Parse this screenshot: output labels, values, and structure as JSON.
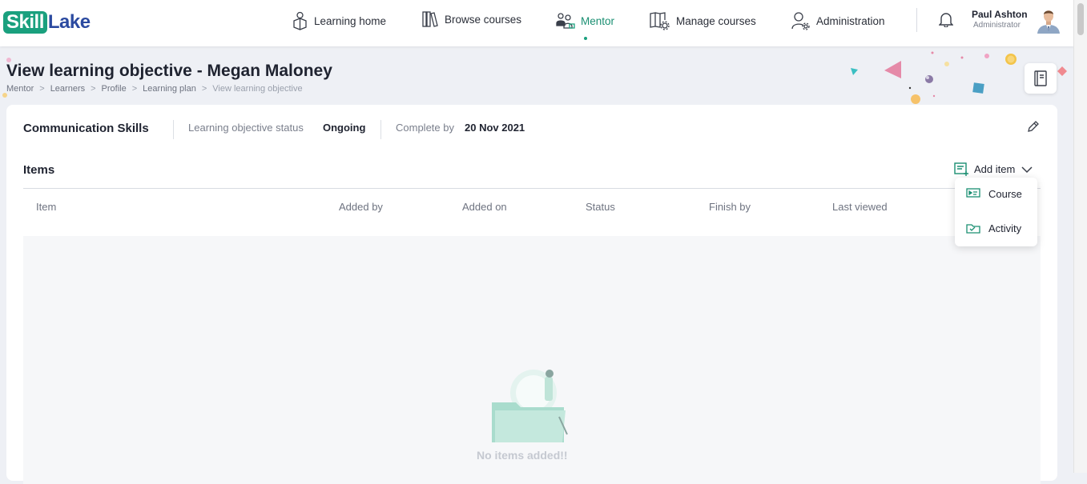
{
  "brand": {
    "part1": "Skill",
    "part2": "Lake"
  },
  "nav": {
    "learning_home": "Learning home",
    "browse_courses": "Browse courses",
    "mentor": "Mentor",
    "manage_courses": "Manage courses",
    "administration": "Administration"
  },
  "user": {
    "name": "Paul Ashton",
    "role": "Administrator"
  },
  "page": {
    "title": "View learning objective - Megan Maloney",
    "breadcrumb": [
      "Mentor",
      "Learners",
      "Profile",
      "Learning plan",
      "View learning objective"
    ]
  },
  "objective": {
    "name": "Communication Skills",
    "status_label": "Learning objective status",
    "status_value": "Ongoing",
    "complete_label": "Complete by",
    "complete_value": "20 Nov 2021"
  },
  "items": {
    "title": "Items",
    "add_label": "Add item",
    "columns": [
      "Item",
      "Added by",
      "Added on",
      "Status",
      "Finish by",
      "Last viewed"
    ],
    "empty_text": "No items added!!"
  },
  "add_menu": {
    "course": "Course",
    "activity": "Activity"
  },
  "colors": {
    "accent": "#1aa07e",
    "brand_blue": "#2b4aa0",
    "background": "#eef0f5"
  },
  "icons": [
    "learning-home-icon",
    "browse-courses-icon",
    "mentor-icon",
    "manage-courses-icon",
    "administration-icon",
    "bell-icon",
    "book-icon",
    "edit-icon",
    "add-item-icon",
    "chevron-down-icon",
    "course-icon",
    "activity-icon"
  ]
}
